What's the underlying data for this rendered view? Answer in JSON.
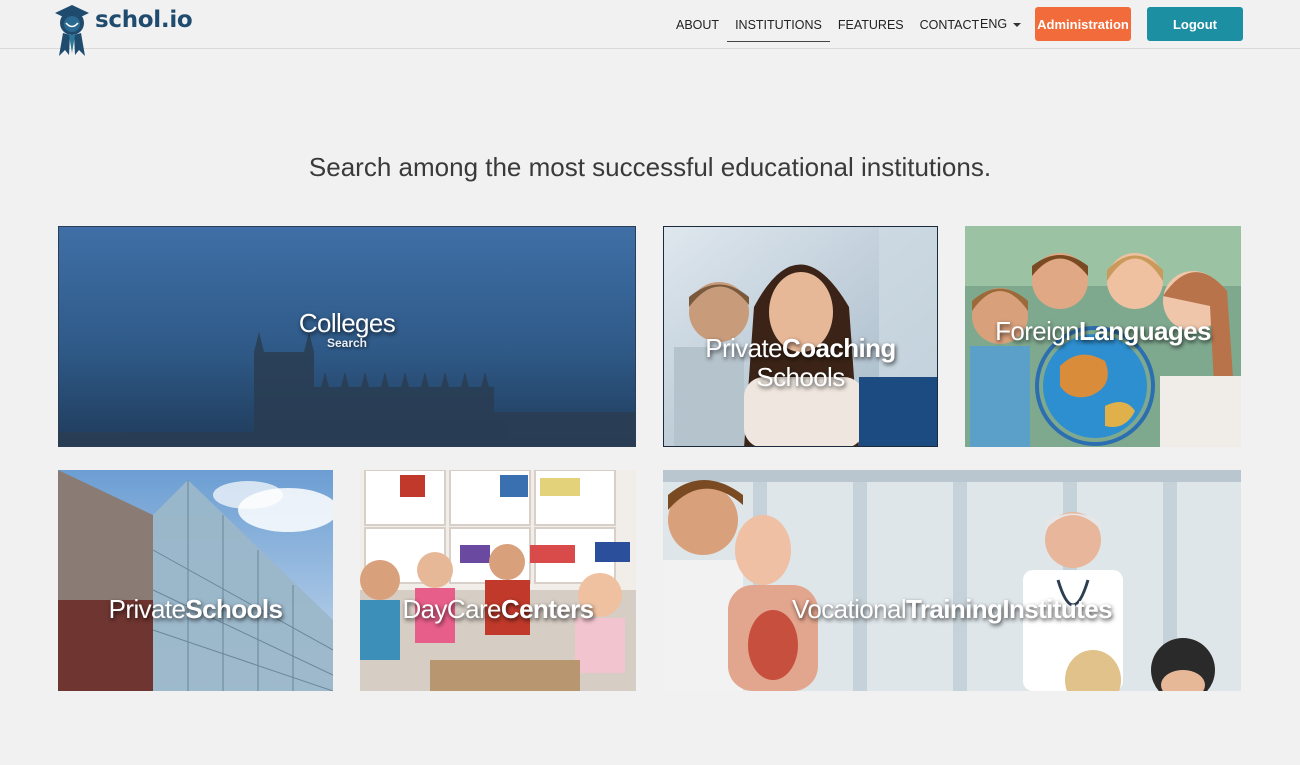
{
  "brand": {
    "name": "schol.io"
  },
  "nav": {
    "links": [
      {
        "label": "ABOUT"
      },
      {
        "label": "INSTITUTIONS"
      },
      {
        "label": "FEATURES"
      },
      {
        "label": "CONTACT"
      }
    ],
    "language": "ENG",
    "admin_label": "Administration",
    "logout_label": "Logout"
  },
  "headline": "Search among the most successful educational institutions.",
  "tiles": {
    "colleges": {
      "label": "Colleges",
      "sub": "Search"
    },
    "coaching": {
      "label_a": "Private",
      "label_b": "Coaching",
      "label_c": "Schools"
    },
    "languages": {
      "label_a": "Foreign",
      "label_b": "Languages"
    },
    "private": {
      "label_a": "Private",
      "label_b": "Schools"
    },
    "daycare": {
      "label_a": "Day",
      "label_b": "Care",
      "label_c": "Centers"
    },
    "vocational": {
      "label_a": "Vocational",
      "label_b": "Training",
      "label_c": "Institutes"
    }
  },
  "colors": {
    "background": "#f1f1f1",
    "brand": "#1e4b6e",
    "admin_button": "#f26b3a",
    "logout_button": "#1d8fa3"
  },
  "icons": [
    "scholio-logo-icon",
    "chevron-down-icon"
  ]
}
